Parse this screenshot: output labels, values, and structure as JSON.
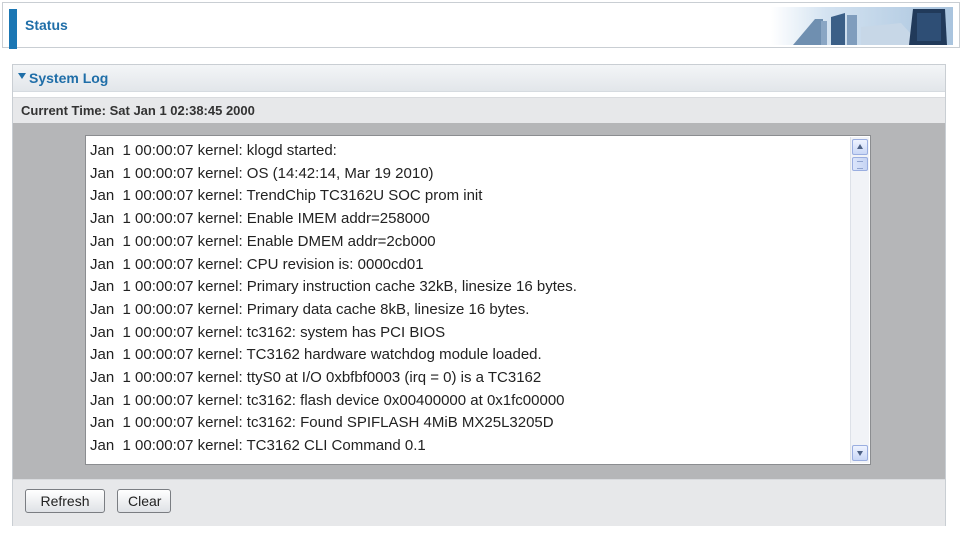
{
  "header": {
    "title": "Status"
  },
  "section": {
    "title": "System Log"
  },
  "current_time": "Current Time: Sat Jan 1 02:38:45 2000",
  "log": {
    "lines": [
      "Jan  1 00:00:07 kernel: klogd started:",
      "Jan  1 00:00:07 kernel: OS (14:42:14, Mar 19 2010)",
      "Jan  1 00:00:07 kernel: TrendChip TC3162U SOC prom init",
      "Jan  1 00:00:07 kernel: Enable IMEM addr=258000",
      "Jan  1 00:00:07 kernel: Enable DMEM addr=2cb000",
      "Jan  1 00:00:07 kernel: CPU revision is: 0000cd01",
      "Jan  1 00:00:07 kernel: Primary instruction cache 32kB, linesize 16 bytes.",
      "Jan  1 00:00:07 kernel: Primary data cache 8kB, linesize 16 bytes.",
      "Jan  1 00:00:07 kernel: tc3162: system has PCI BIOS",
      "Jan  1 00:00:07 kernel: TC3162 hardware watchdog module loaded.",
      "Jan  1 00:00:07 kernel: ttyS0 at I/O 0xbfbf0003 (irq = 0) is a TC3162",
      "Jan  1 00:00:07 kernel: tc3162: flash device 0x00400000 at 0x1fc00000",
      "Jan  1 00:00:07 kernel: tc3162: Found SPIFLASH 4MiB MX25L3205D",
      "Jan  1 00:00:07 kernel: TC3162 CLI Command 0.1"
    ]
  },
  "buttons": {
    "refresh": "Refresh",
    "clear": "Clear"
  },
  "icons": {
    "section_toggle": "triangle-down-icon",
    "scroll_up": "chevron-up-icon",
    "scroll_down": "chevron-down-icon"
  },
  "colors": {
    "accent": "#1b77b4",
    "title_text": "#1f6ea8",
    "log_background": "#b5b6b8"
  }
}
